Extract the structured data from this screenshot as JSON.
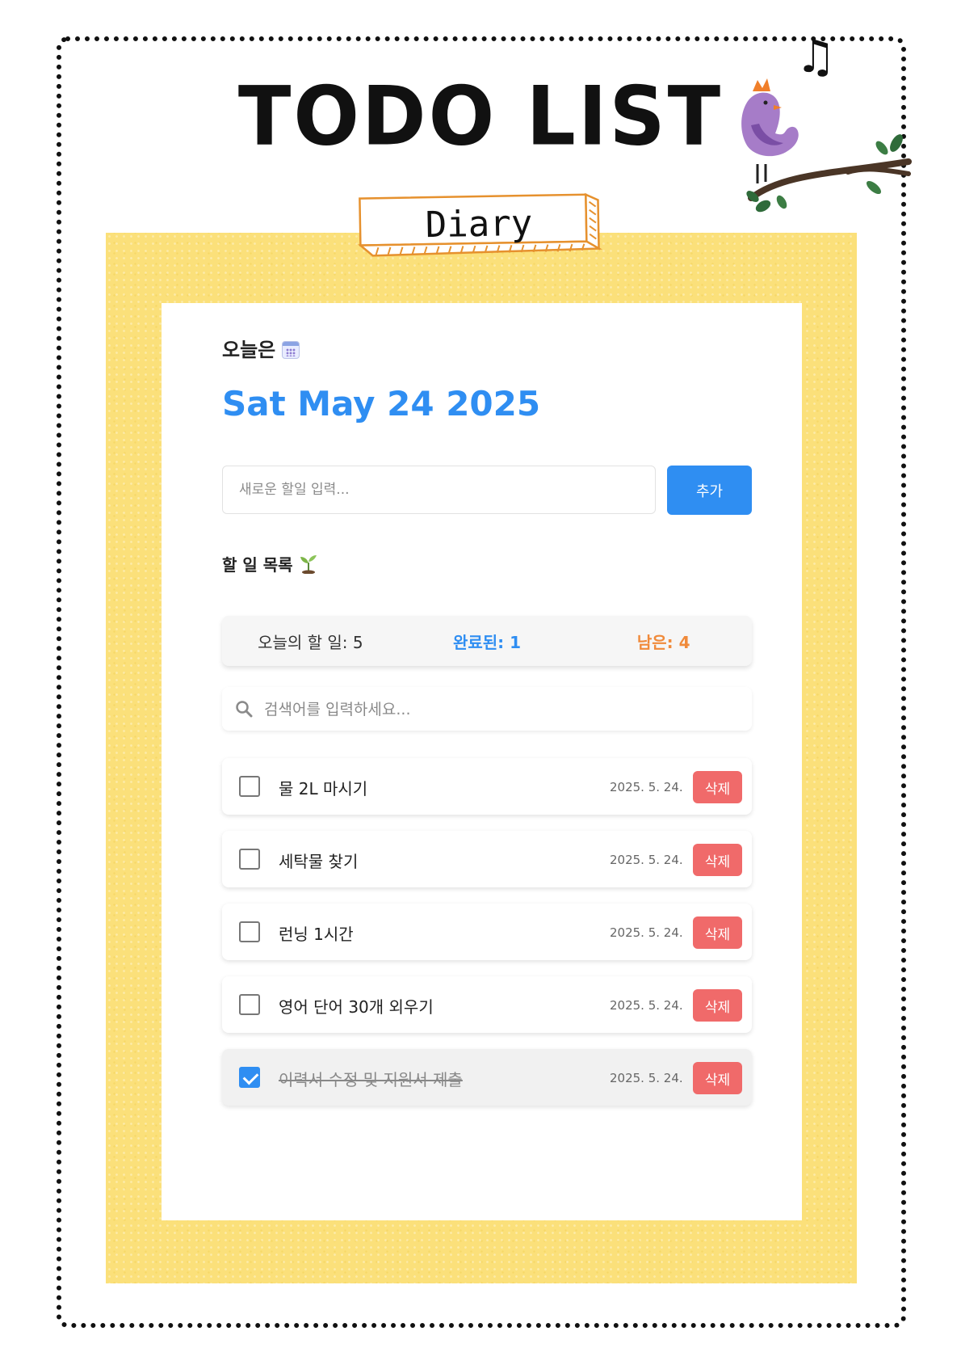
{
  "header": {
    "title": "TODO LIST",
    "tag": "Diary"
  },
  "card": {
    "today_label": "오늘은",
    "date": "Sat May 24 2025",
    "new_todo": {
      "placeholder": "새로운 할일 입력...",
      "value": ""
    },
    "add_label": "추가",
    "list_heading": "할 일 목록",
    "stats": {
      "total": "오늘의 할 일: 5",
      "completed": "완료된: 1",
      "remaining": "남은: 4"
    },
    "search": {
      "placeholder": "검색어를 입력하세요...",
      "value": ""
    },
    "todos": [
      {
        "text": "물 2L 마시기",
        "date": "2025. 5. 24.",
        "done": false,
        "delete_label": "삭제"
      },
      {
        "text": "세탁물 찾기",
        "date": "2025. 5. 24.",
        "done": false,
        "delete_label": "삭제"
      },
      {
        "text": "런닝 1시간",
        "date": "2025. 5. 24.",
        "done": false,
        "delete_label": "삭제"
      },
      {
        "text": "영어 단어 30개 외우기",
        "date": "2025. 5. 24.",
        "done": false,
        "delete_label": "삭제"
      },
      {
        "text": "이력서 수정 및 지원서 제출",
        "date": "2025. 5. 24.",
        "done": true,
        "delete_label": "삭제"
      }
    ]
  },
  "icons": {
    "calendar": "calendar-icon",
    "sprout": "sprout-icon",
    "search": "search-icon",
    "music_note": "music-note-icon",
    "bird": "bird-illustration"
  },
  "colors": {
    "accent": "#2f8ef2",
    "remaining": "#f08a3a",
    "delete": "#f06a6a",
    "paper": "#fbe07a"
  }
}
